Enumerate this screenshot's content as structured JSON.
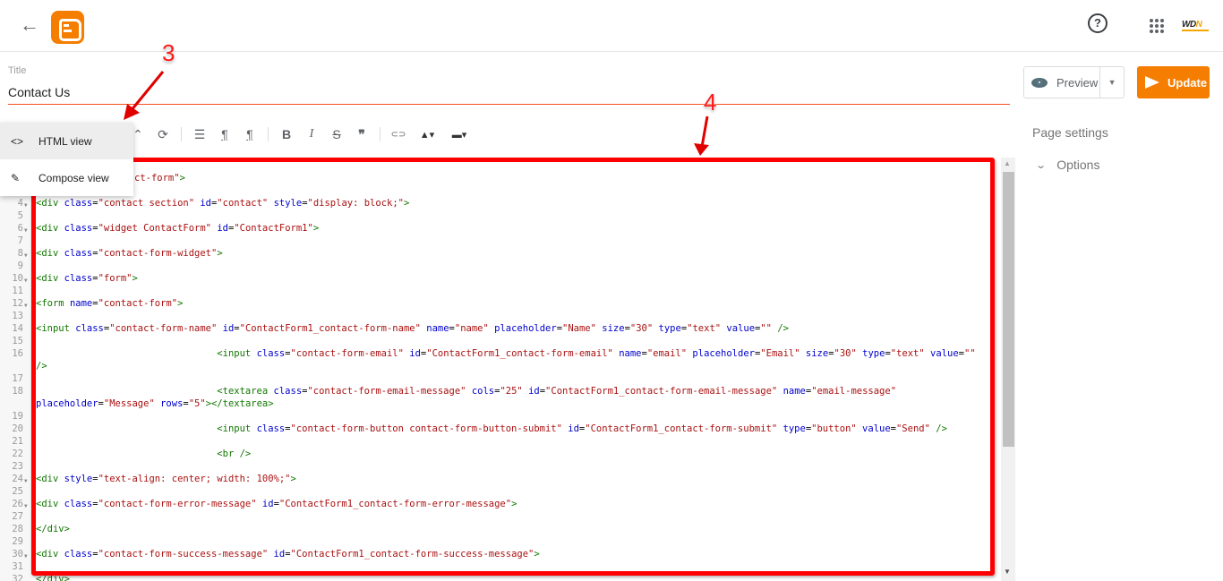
{
  "header": {
    "back_icon": "arrow-left-icon",
    "logo": "blogger-logo",
    "help_icon": "question-circle-icon",
    "apps_icon": "apps-grid-icon",
    "account_brand": {
      "prefix": "WD",
      "suffix": "N"
    }
  },
  "title_field": {
    "label": "Title",
    "value": "Contact Us"
  },
  "annotations": {
    "step3": "3",
    "step4": "4"
  },
  "view_menu": {
    "items": [
      {
        "icon": "code-icon",
        "glyph": "<>",
        "label": "HTML view",
        "selected": true
      },
      {
        "icon": "pencil-icon",
        "glyph": "✎",
        "label": "Compose view",
        "selected": false
      }
    ]
  },
  "toolbar": {
    "items": [
      {
        "name": "caret",
        "glyph": "⌃"
      },
      {
        "name": "find-replace",
        "glyph": "⟳"
      },
      {
        "name": "align",
        "glyph": "☰"
      },
      {
        "name": "ltr",
        "glyph": "¶"
      },
      {
        "name": "rtl",
        "glyph": "¶"
      },
      {
        "name": "bold",
        "glyph": "B"
      },
      {
        "name": "italic",
        "glyph": "I"
      },
      {
        "name": "strikethrough",
        "glyph": "S"
      },
      {
        "name": "quote",
        "glyph": "❞"
      },
      {
        "name": "link",
        "glyph": "⊂⊃"
      },
      {
        "name": "image",
        "glyph": "▲▾"
      },
      {
        "name": "video",
        "glyph": "▬▾"
      }
    ]
  },
  "actions": {
    "preview_label": "Preview",
    "update_label": "Update"
  },
  "sidebar": {
    "page_settings": "Page settings",
    "options": "Options"
  },
  "editor": {
    "lines": [
      {
        "n": "",
        "fold": false,
        "indent": 0,
        "tokens": [
          [
            "tx",
            ""
          ],
          [
            "av",
            "ct-form\""
          ],
          [
            "tg",
            ">"
          ]
        ],
        "partial": true
      },
      {
        "n": "4",
        "fold": true,
        "indent": 0,
        "tokens": [
          [
            "tg",
            "<div"
          ],
          [
            "tx",
            " "
          ],
          [
            "an",
            "class"
          ],
          [
            "tx",
            "="
          ],
          [
            "av",
            "\"contact section\""
          ],
          [
            "tx",
            " "
          ],
          [
            "an",
            "id"
          ],
          [
            "tx",
            "="
          ],
          [
            "av",
            "\"contact\""
          ],
          [
            "tx",
            " "
          ],
          [
            "an",
            "style"
          ],
          [
            "tx",
            "="
          ],
          [
            "av",
            "\"display: block;\""
          ],
          [
            "tg",
            ">"
          ]
        ]
      },
      {
        "n": "5"
      },
      {
        "n": "6",
        "fold": true,
        "tokens": [
          [
            "tg",
            "<div"
          ],
          [
            "tx",
            " "
          ],
          [
            "an",
            "class"
          ],
          [
            "tx",
            "="
          ],
          [
            "av",
            "\"widget ContactForm\""
          ],
          [
            "tx",
            " "
          ],
          [
            "an",
            "id"
          ],
          [
            "tx",
            "="
          ],
          [
            "av",
            "\"ContactForm1\""
          ],
          [
            "tg",
            ">"
          ]
        ]
      },
      {
        "n": "7"
      },
      {
        "n": "8",
        "fold": true,
        "tokens": [
          [
            "tg",
            "<div"
          ],
          [
            "tx",
            " "
          ],
          [
            "an",
            "class"
          ],
          [
            "tx",
            "="
          ],
          [
            "av",
            "\"contact-form-widget\""
          ],
          [
            "tg",
            ">"
          ]
        ]
      },
      {
        "n": "9"
      },
      {
        "n": "10",
        "fold": true,
        "tokens": [
          [
            "tg",
            "<div"
          ],
          [
            "tx",
            " "
          ],
          [
            "an",
            "class"
          ],
          [
            "tx",
            "="
          ],
          [
            "av",
            "\"form\""
          ],
          [
            "tg",
            ">"
          ]
        ]
      },
      {
        "n": "11"
      },
      {
        "n": "12",
        "fold": true,
        "tokens": [
          [
            "tg",
            "<form"
          ],
          [
            "tx",
            " "
          ],
          [
            "an",
            "name"
          ],
          [
            "tx",
            "="
          ],
          [
            "av",
            "\"contact-form\""
          ],
          [
            "tg",
            ">"
          ]
        ]
      },
      {
        "n": "13"
      },
      {
        "n": "14",
        "tokens": [
          [
            "tg",
            "<input"
          ],
          [
            "tx",
            " "
          ],
          [
            "an",
            "class"
          ],
          [
            "tx",
            "="
          ],
          [
            "av",
            "\"contact-form-name\""
          ],
          [
            "tx",
            " "
          ],
          [
            "an",
            "id"
          ],
          [
            "tx",
            "="
          ],
          [
            "av",
            "\"ContactForm1_contact-form-name\""
          ],
          [
            "tx",
            " "
          ],
          [
            "an",
            "name"
          ],
          [
            "tx",
            "="
          ],
          [
            "av",
            "\"name\""
          ],
          [
            "tx",
            " "
          ],
          [
            "an",
            "placeholder"
          ],
          [
            "tx",
            "="
          ],
          [
            "av",
            "\"Name\""
          ],
          [
            "tx",
            " "
          ],
          [
            "an",
            "size"
          ],
          [
            "tx",
            "="
          ],
          [
            "av",
            "\"30\""
          ],
          [
            "tx",
            " "
          ],
          [
            "an",
            "type"
          ],
          [
            "tx",
            "="
          ],
          [
            "av",
            "\"text\""
          ],
          [
            "tx",
            " "
          ],
          [
            "an",
            "value"
          ],
          [
            "tx",
            "="
          ],
          [
            "av",
            "\"\""
          ],
          [
            "tx",
            " "
          ],
          [
            "tg",
            "/>"
          ]
        ]
      },
      {
        "n": "15"
      },
      {
        "n": "16",
        "tokens": [
          [
            "tx",
            "                                "
          ],
          [
            "tg",
            "<input"
          ],
          [
            "tx",
            " "
          ],
          [
            "an",
            "class"
          ],
          [
            "tx",
            "="
          ],
          [
            "av",
            "\"contact-form-email\""
          ],
          [
            "tx",
            " "
          ],
          [
            "an",
            "id"
          ],
          [
            "tx",
            "="
          ],
          [
            "av",
            "\"ContactForm1_contact-form-email\""
          ],
          [
            "tx",
            " "
          ],
          [
            "an",
            "name"
          ],
          [
            "tx",
            "="
          ],
          [
            "av",
            "\"email\""
          ],
          [
            "tx",
            " "
          ],
          [
            "an",
            "placeholder"
          ],
          [
            "tx",
            "="
          ],
          [
            "av",
            "\"Email\""
          ],
          [
            "tx",
            " "
          ],
          [
            "an",
            "size"
          ],
          [
            "tx",
            "="
          ],
          [
            "av",
            "\"30\""
          ],
          [
            "tx",
            " "
          ],
          [
            "an",
            "type"
          ],
          [
            "tx",
            "="
          ],
          [
            "av",
            "\"text\""
          ],
          [
            "tx",
            " "
          ],
          [
            "an",
            "value"
          ],
          [
            "tx",
            "="
          ],
          [
            "av",
            "\"\""
          ]
        ]
      },
      {
        "n": "",
        "tokens": [
          [
            "tg",
            "/>"
          ]
        ]
      },
      {
        "n": "17"
      },
      {
        "n": "18",
        "tokens": [
          [
            "tx",
            "                                "
          ],
          [
            "tg",
            "<textarea"
          ],
          [
            "tx",
            " "
          ],
          [
            "an",
            "class"
          ],
          [
            "tx",
            "="
          ],
          [
            "av",
            "\"contact-form-email-message\""
          ],
          [
            "tx",
            " "
          ],
          [
            "an",
            "cols"
          ],
          [
            "tx",
            "="
          ],
          [
            "av",
            "\"25\""
          ],
          [
            "tx",
            " "
          ],
          [
            "an",
            "id"
          ],
          [
            "tx",
            "="
          ],
          [
            "av",
            "\"ContactForm1_contact-form-email-message\""
          ],
          [
            "tx",
            " "
          ],
          [
            "an",
            "name"
          ],
          [
            "tx",
            "="
          ],
          [
            "av",
            "\"email-message\""
          ]
        ]
      },
      {
        "n": "",
        "tokens": [
          [
            "an",
            "placeholder"
          ],
          [
            "tx",
            "="
          ],
          [
            "av",
            "\"Message\""
          ],
          [
            "tx",
            " "
          ],
          [
            "an",
            "rows"
          ],
          [
            "tx",
            "="
          ],
          [
            "av",
            "\"5\""
          ],
          [
            "tg",
            "></textarea>"
          ]
        ]
      },
      {
        "n": "19"
      },
      {
        "n": "20",
        "tokens": [
          [
            "tx",
            "                                "
          ],
          [
            "tg",
            "<input"
          ],
          [
            "tx",
            " "
          ],
          [
            "an",
            "class"
          ],
          [
            "tx",
            "="
          ],
          [
            "av",
            "\"contact-form-button contact-form-button-submit\""
          ],
          [
            "tx",
            " "
          ],
          [
            "an",
            "id"
          ],
          [
            "tx",
            "="
          ],
          [
            "av",
            "\"ContactForm1_contact-form-submit\""
          ],
          [
            "tx",
            " "
          ],
          [
            "an",
            "type"
          ],
          [
            "tx",
            "="
          ],
          [
            "av",
            "\"button\""
          ],
          [
            "tx",
            " "
          ],
          [
            "an",
            "value"
          ],
          [
            "tx",
            "="
          ],
          [
            "av",
            "\"Send\""
          ],
          [
            "tx",
            " "
          ],
          [
            "tg",
            "/>"
          ]
        ]
      },
      {
        "n": "21"
      },
      {
        "n": "22",
        "tokens": [
          [
            "tx",
            "                                "
          ],
          [
            "tg",
            "<br />"
          ]
        ]
      },
      {
        "n": "23"
      },
      {
        "n": "24",
        "fold": true,
        "tokens": [
          [
            "tg",
            "<div"
          ],
          [
            "tx",
            " "
          ],
          [
            "an",
            "style"
          ],
          [
            "tx",
            "="
          ],
          [
            "av",
            "\"text-align: center; width: 100%;\""
          ],
          [
            "tg",
            ">"
          ]
        ]
      },
      {
        "n": "25"
      },
      {
        "n": "26",
        "fold": true,
        "tokens": [
          [
            "tg",
            "<div"
          ],
          [
            "tx",
            " "
          ],
          [
            "an",
            "class"
          ],
          [
            "tx",
            "="
          ],
          [
            "av",
            "\"contact-form-error-message\""
          ],
          [
            "tx",
            " "
          ],
          [
            "an",
            "id"
          ],
          [
            "tx",
            "="
          ],
          [
            "av",
            "\"ContactForm1_contact-form-error-message\""
          ],
          [
            "tg",
            ">"
          ]
        ]
      },
      {
        "n": "27"
      },
      {
        "n": "28",
        "tokens": [
          [
            "tg",
            "</div>"
          ]
        ]
      },
      {
        "n": "29"
      },
      {
        "n": "30",
        "fold": true,
        "tokens": [
          [
            "tg",
            "<div"
          ],
          [
            "tx",
            " "
          ],
          [
            "an",
            "class"
          ],
          [
            "tx",
            "="
          ],
          [
            "av",
            "\"contact-form-success-message\""
          ],
          [
            "tx",
            " "
          ],
          [
            "an",
            "id"
          ],
          [
            "tx",
            "="
          ],
          [
            "av",
            "\"ContactForm1_contact-form-success-message\""
          ],
          [
            "tg",
            ">"
          ]
        ]
      },
      {
        "n": "31"
      },
      {
        "n": "32",
        "tokens": [
          [
            "tg",
            "</div>"
          ]
        ]
      }
    ]
  },
  "colors": {
    "brand_orange": "#f57d00",
    "title_underline": "#f4511e",
    "annotation_red": "#ff0000",
    "code_tag": "#117700",
    "code_attr_name": "#0000cc",
    "code_attr_value": "#aa1111"
  }
}
